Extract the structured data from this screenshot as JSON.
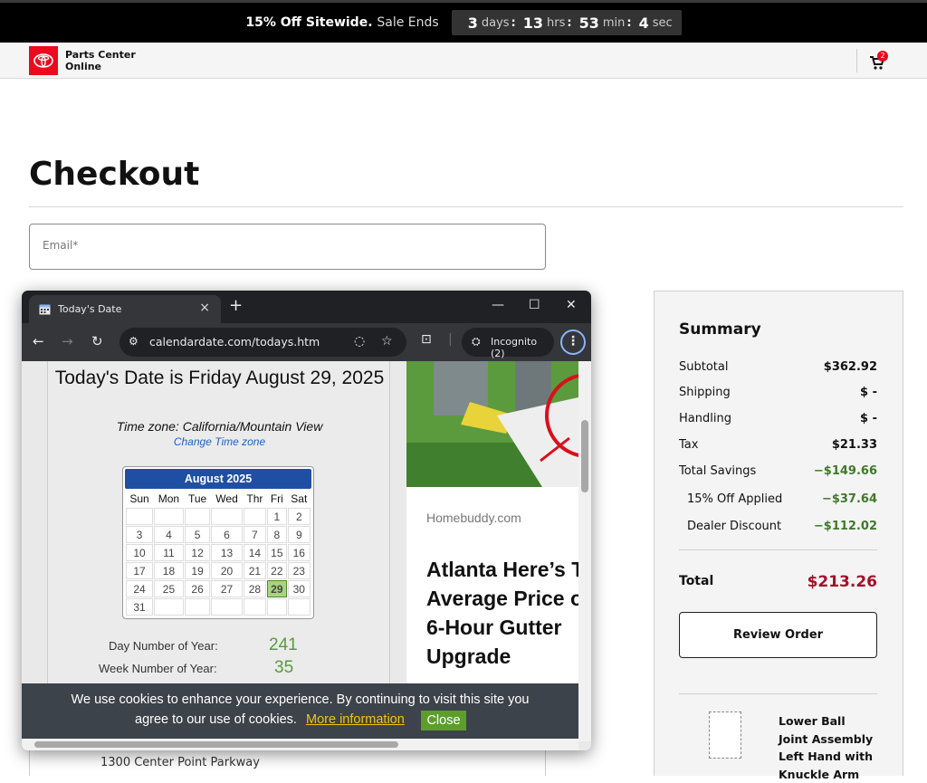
{
  "promo": {
    "bold": "15% Off Sitewide.",
    "light": "Sale Ends",
    "days": "3",
    "days_unit": "days",
    "hrs": "13",
    "hrs_unit": "hrs",
    "min": "53",
    "min_unit": "min",
    "sec": "4",
    "sec_unit": "sec"
  },
  "header": {
    "brand_line1": "Parts Center",
    "brand_line2": "Online",
    "cart_count": "2"
  },
  "checkout": {
    "title": "Checkout",
    "email_placeholder": "Email*"
  },
  "address": "1300 Center Point Parkway",
  "summary": {
    "title": "Summary",
    "rows": [
      {
        "label": "Subtotal",
        "value": "$362.92"
      },
      {
        "label": "Shipping",
        "value": "$ -"
      },
      {
        "label": "Handling",
        "value": "$ -"
      },
      {
        "label": "Tax",
        "value": "$21.33"
      },
      {
        "label": "Total Savings",
        "value": "−$149.66"
      },
      {
        "label": "15% Off Applied",
        "value": "−$37.64"
      },
      {
        "label": "Dealer Discount",
        "value": "−$112.02"
      }
    ],
    "total_label": "Total",
    "total_value": "$213.26",
    "review_button": "Review Order",
    "product_name": "Lower Ball Joint Assembly Left Hand with Knuckle Arm"
  },
  "browser": {
    "tab_title": "Today's Date",
    "url": "calendardate.com/todays.htm",
    "incognito_label": "Incognito (2)"
  },
  "page": {
    "heading": "Today's Date is Friday August 29, 2025",
    "timezone": "Time zone: California/Mountain View",
    "change_tz": "Change Time zone",
    "calendar_month": "August 2025",
    "weekdays": [
      "Sun",
      "Mon",
      "Tue",
      "Wed",
      "Thr",
      "Fri",
      "Sat"
    ],
    "weeks": [
      [
        "",
        "",
        "",
        "",
        "",
        "1",
        "2"
      ],
      [
        "3",
        "4",
        "5",
        "6",
        "7",
        "8",
        "9"
      ],
      [
        "10",
        "11",
        "12",
        "13",
        "14",
        "15",
        "16"
      ],
      [
        "17",
        "18",
        "19",
        "20",
        "21",
        "22",
        "23"
      ],
      [
        "24",
        "25",
        "26",
        "27",
        "28",
        "29",
        "30"
      ],
      [
        "31",
        "",
        "",
        "",
        "",
        "",
        ""
      ]
    ],
    "today_day": "29",
    "day_of_year_label": "Day Number of Year:",
    "day_of_year": "241",
    "week_of_year_label": "Week Number of Year:",
    "week_of_year": "35",
    "ad_source": "Homebuddy.com",
    "ad_headline": [
      "Atlanta Here’s T",
      "Average Price o",
      "6-Hour Gutter",
      "Upgrade"
    ],
    "cookie_line1": "We use cookies to enhance your experience. By continuing to visit this site you",
    "cookie_line2": "agree to our use of cookies.",
    "cookie_more": "More information",
    "cookie_close": "Close"
  }
}
